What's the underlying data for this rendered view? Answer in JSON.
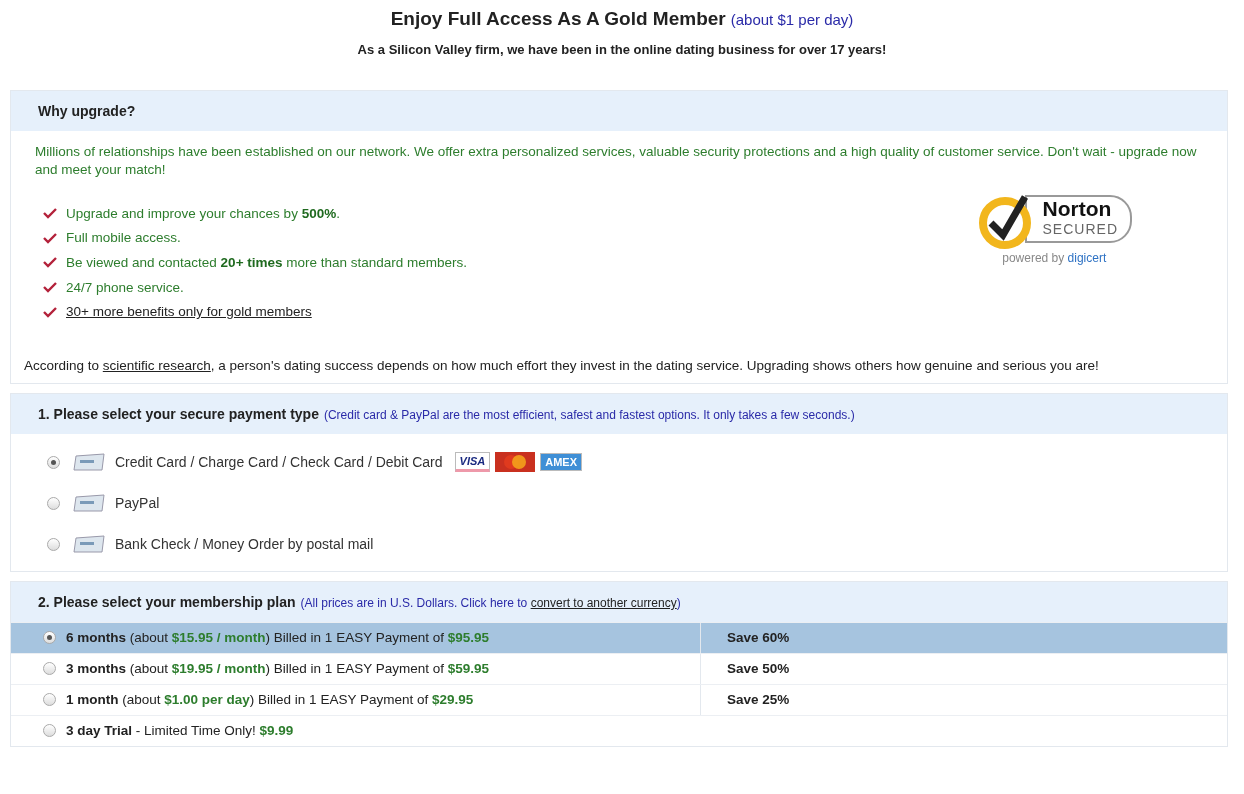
{
  "header": {
    "title": "Enjoy Full Access As A Gold Member",
    "title_note": "(about $1 per day)",
    "subtitle": "As a Silicon Valley firm, we have been in the online dating business for over **17** years!"
  },
  "why": {
    "heading": "Why upgrade?",
    "intro": "Millions of relationships have been established on our network. We offer extra personalized services, valuable security protections and a high quality of customer service. Don't wait - upgrade now and meet your match!",
    "benefits": [
      {
        "kind": "text",
        "text": "Upgrade and improve your chances by **500%**."
      },
      {
        "kind": "text",
        "text": "Full mobile access."
      },
      {
        "kind": "text",
        "text": "Be viewed and contacted **20+ times** more than standard members."
      },
      {
        "kind": "text",
        "text": "24/7 phone service."
      },
      {
        "kind": "link",
        "text": "30+ more benefits only for gold members"
      }
    ],
    "badge": {
      "brand": "Norton",
      "status": "SECURED",
      "powered": "powered by",
      "provider": "digicert"
    },
    "research": {
      "before": "According to",
      "link": "scientific research",
      "after": ", a person's dating success depends on how much effort they invest in the dating service. Upgrading shows others how genuine and serious you are!"
    }
  },
  "payment": {
    "heading": "1. Please select your secure payment type",
    "note": "(Credit card & PayPal are the most efficient, safest and fastest options. It only takes a few seconds.)",
    "options": [
      {
        "label": "Credit Card / Charge Card / Check Card / Debit Card",
        "selected": true,
        "logos": [
          {
            "kind": "visa",
            "label": "VISA"
          },
          {
            "kind": "mastercard"
          },
          {
            "kind": "amex",
            "label": "AMEX"
          }
        ]
      },
      {
        "label": "PayPal",
        "selected": false
      },
      {
        "label": "Bank Check / Money Order by postal mail",
        "selected": false
      }
    ]
  },
  "plan": {
    "heading": "2. Please select your membership plan",
    "note": "(All prices are in U.S. Dollars. Click here to",
    "note_link": "convert to another currency",
    "note_end": ")",
    "plans": [
      {
        "kind": "plan",
        "term": "6 months",
        "pre": "(about",
        "rate": "$15.95 / month",
        "post": ") Billed in 1 EASY Payment of",
        "price": "$95.95",
        "save": "Save 60%",
        "selected": true
      },
      {
        "kind": "plan",
        "term": "3 months",
        "pre": "(about",
        "rate": "$19.95 / month",
        "post": ") Billed in 1 EASY Payment of",
        "price": "$59.95",
        "save": "Save 50%",
        "selected": false
      },
      {
        "kind": "plan",
        "term": "1 month",
        "pre": "(about",
        "rate": "$1.00 per day",
        "post": ") Billed in 1 EASY Payment of",
        "price": "$29.95",
        "save": "Save 25%",
        "selected": false
      },
      {
        "kind": "trial",
        "term": "3 day Trial",
        "pre": "- Limited Time Only!",
        "price": "$9.99",
        "selected": false
      }
    ]
  }
}
